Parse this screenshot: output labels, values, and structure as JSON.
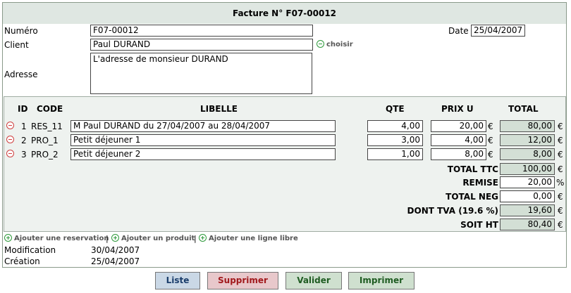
{
  "title": "Facture N° F07-00012",
  "form": {
    "numero_label": "Numéro",
    "numero_value": "F07-00012",
    "date_label": "Date",
    "date_value": "25/04/2007",
    "client_label": "Client",
    "client_value": "Paul DURAND",
    "choisir_label": "choisir",
    "adresse_label": "Adresse",
    "adresse_value": "L'adresse de monsieur DURAND"
  },
  "table": {
    "headers": {
      "id": "ID",
      "code": "CODE",
      "libelle": "LIBELLE",
      "qte": "QTE",
      "prix": "PRIX U",
      "total": "TOTAL"
    },
    "rows": [
      {
        "id": "1",
        "code": "RES_11",
        "libelle": "M Paul DURAND du 27/04/2007 au 28/04/2007",
        "qte": "4,00",
        "prix": "20,00",
        "total": "80,00"
      },
      {
        "id": "2",
        "code": "PRO_1",
        "libelle": "Petit déjeuner 1",
        "qte": "3,00",
        "prix": "4,00",
        "total": "12,00"
      },
      {
        "id": "3",
        "code": "PRO_2",
        "libelle": "Petit déjeuner 2",
        "qte": "1,00",
        "prix": "8,00",
        "total": "8,00"
      }
    ],
    "currency": "€",
    "percent": "%"
  },
  "summary": {
    "total_ttc_label": "TOTAL TTC",
    "total_ttc": "100,00",
    "remise_label": "REMISE",
    "remise": "20,00",
    "total_neg_label": "TOTAL NEG",
    "total_neg": "0,00",
    "dont_tva_label": "DONT TVA (19.6 %)",
    "dont_tva": "19,60",
    "soit_ht_label": "SOIT HT",
    "soit_ht": "80,40"
  },
  "add_links": {
    "reservation": "Ajouter une reservation",
    "produit": "Ajouter un produit",
    "ligne_libre": "Ajouter une ligne libre",
    "separator": "|"
  },
  "meta": {
    "modification_label": "Modification",
    "modification_value": "30/04/2007",
    "creation_label": "Création",
    "creation_value": "25/04/2007"
  },
  "buttons": {
    "liste": "Liste",
    "supprimer": "Supprimer",
    "valider": "Valider",
    "imprimer": "Imprimer"
  },
  "icons": {
    "remove_row": "minus-circle-icon",
    "choose_client": "minus-circle-icon",
    "add": "plus-circle-icon"
  }
}
